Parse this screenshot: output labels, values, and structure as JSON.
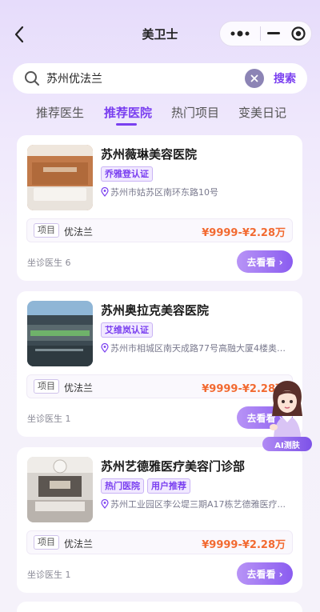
{
  "header": {
    "title": "美卫士"
  },
  "search": {
    "value": "苏州优法兰",
    "button_label": "搜索"
  },
  "tabs": [
    {
      "label": "推荐医生",
      "active": false
    },
    {
      "label": "推荐医院",
      "active": true
    },
    {
      "label": "热门项目",
      "active": false
    },
    {
      "label": "变美日记",
      "active": false
    }
  ],
  "hospitals": [
    {
      "name": "苏州薇琳美容医院",
      "tags": [
        "乔雅登认证"
      ],
      "address": "苏州市姑苏区南环东路10号",
      "item_tag": "项目",
      "item_name": "优法兰",
      "price": "¥9999-¥2.28万",
      "doctors": "坐诊医生 6",
      "button": "去看看 ›"
    },
    {
      "name": "苏州奥拉克美容医院",
      "tags": [
        "艾维岚认证"
      ],
      "address": "苏州市相城区南天成路77号高融大厦4楼奥拉...",
      "item_tag": "项目",
      "item_name": "优法兰",
      "price": "¥9999-¥2.28万",
      "doctors": "坐诊医生 1",
      "button": "去看看 ›"
    },
    {
      "name": "苏州艺德雅医疗美容门诊部",
      "tags": [
        "热门医院",
        "用户推荐"
      ],
      "address": "苏州工业园区李公堤三期A17栋艺德雅医疗...",
      "item_tag": "项目",
      "item_name": "优法兰",
      "price": "¥9999-¥2.28万",
      "doctors": "坐诊医生 1",
      "button": "去看看 ›"
    }
  ],
  "ai_widget": {
    "label": "AI测肤"
  },
  "colors": {
    "accent": "#7a3ff0",
    "price": "#f26a31",
    "tag_bg": "#f1e9ff"
  }
}
